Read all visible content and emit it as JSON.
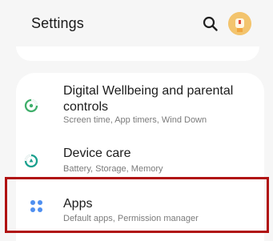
{
  "header": {
    "title": "Settings"
  },
  "items": [
    {
      "title": "Digital Wellbeing and parental controls",
      "subtitle": "Screen time, App timers, Wind Down"
    },
    {
      "title": "Device care",
      "subtitle": "Battery, Storage, Memory"
    },
    {
      "title": "Apps",
      "subtitle": "Default apps, Permission manager"
    }
  ],
  "icons": {
    "header": [
      "search-icon",
      "avatar"
    ],
    "items": [
      "digital-wellbeing-icon",
      "device-care-icon",
      "apps-icon"
    ]
  },
  "colors": {
    "wellbeing_icon": "#3fae6a",
    "device_care_icon": "#19a08e",
    "apps_icon": "#4f8ff0",
    "highlight_border": "#b01212"
  }
}
